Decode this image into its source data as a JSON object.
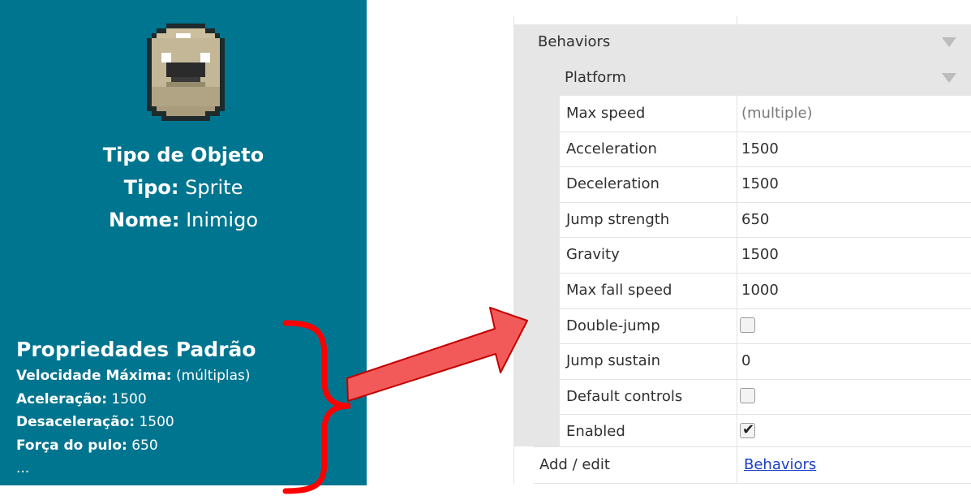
{
  "card": {
    "title": "Tipo de Objeto",
    "type_label": "Tipo:",
    "type_value": "Sprite",
    "name_label": "Nome:",
    "name_value": "Inimigo",
    "props_heading": "Propriedades Padrão",
    "props": [
      {
        "label": "Velocidade Máxima:",
        "value": "(múltiplas)"
      },
      {
        "label": "Aceleração:",
        "value": "1500"
      },
      {
        "label": "Desaceleração:",
        "value": "1500"
      },
      {
        "label": "Força do pulo:",
        "value": "650"
      }
    ],
    "ellipsis": "..."
  },
  "grid": {
    "section": "Behaviors",
    "subsection": "Platform",
    "rows": [
      {
        "name": "Max speed",
        "value": "(multiple)"
      },
      {
        "name": "Acceleration",
        "value": "1500"
      },
      {
        "name": "Deceleration",
        "value": "1500"
      },
      {
        "name": "Jump strength",
        "value": "650"
      },
      {
        "name": "Gravity",
        "value": "1500"
      },
      {
        "name": "Max fall speed",
        "value": "1000"
      },
      {
        "name": "Double-jump",
        "checked": false
      },
      {
        "name": "Jump sustain",
        "value": "0"
      },
      {
        "name": "Default controls",
        "checked": false
      },
      {
        "name": "Enabled",
        "checked": true
      }
    ],
    "footer_label": "Add / edit",
    "footer_link": "Behaviors"
  },
  "colors": {
    "card_bg": "#00758f",
    "brace": "#ff0000",
    "arrow_fill": "#f25a5a",
    "arrow_stroke": "#c40000",
    "link": "#1a3fc8"
  },
  "icons": {
    "sprite": "enemy-blob-pixel-art",
    "collapse": "triangle-down-icon",
    "check": "checkmark-icon"
  }
}
